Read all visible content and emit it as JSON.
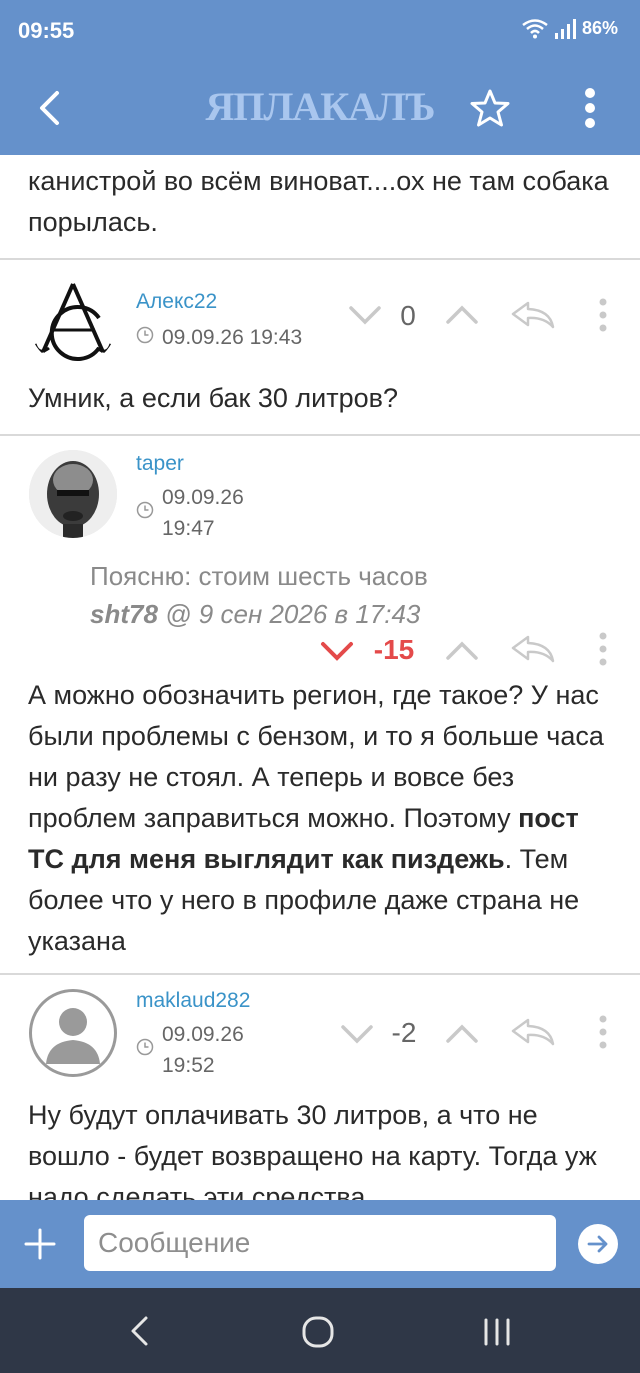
{
  "status_bar": {
    "time": "09:55",
    "battery": "86%"
  },
  "header": {
    "logo": "ЯПЛАКАЛЪ"
  },
  "previous_text": "канистрой во всём виноват....ох не там собака порылась.",
  "comments": [
    {
      "username": "Алекс22",
      "datetime": "09.09.26 19:43",
      "score": "0",
      "body": "Умник, а если бак 30 литров?"
    },
    {
      "username": "taper",
      "datetime_line1": "09.09.26",
      "datetime_line2": "19:47",
      "score": "-15",
      "quote_text": "Поясню: стоим шесть часов",
      "quote_author": "sht78",
      "quote_at": "@",
      "quote_date": "9 сен 2026 в 17:43",
      "body_part1": "А можно обозначить регион, где такое? У нас были проблемы с бензом, и то я больше часа ни разу не стоял. А теперь и вовсе без проблем заправиться можно. Поэтому ",
      "body_bold": "пост ТС для меня выглядит как пиздежь",
      "body_part2": ". Тем более что у него в профиле даже страна не указана"
    },
    {
      "username": "maklaud282",
      "datetime_line1": "09.09.26",
      "datetime_line2": "19:52",
      "score": "-2",
      "body": "Ну будут оплачивать 30 литров, а что не вошло - будет возвращено на карту. Тогда уж надо сделать эти средства"
    }
  ],
  "composer": {
    "placeholder": "Сообщение"
  },
  "colors": {
    "header": "#6591cb",
    "link": "#3a93c8",
    "negative": "#e44a4a",
    "navbar": "#2f3747"
  },
  "icons": [
    "back-arrow-icon",
    "star-icon",
    "more-vert-icon",
    "chevron-down-icon",
    "chevron-up-icon",
    "reply-icon",
    "clock-icon",
    "plus-icon",
    "send-icon",
    "wifi-icon",
    "signal-icon"
  ]
}
